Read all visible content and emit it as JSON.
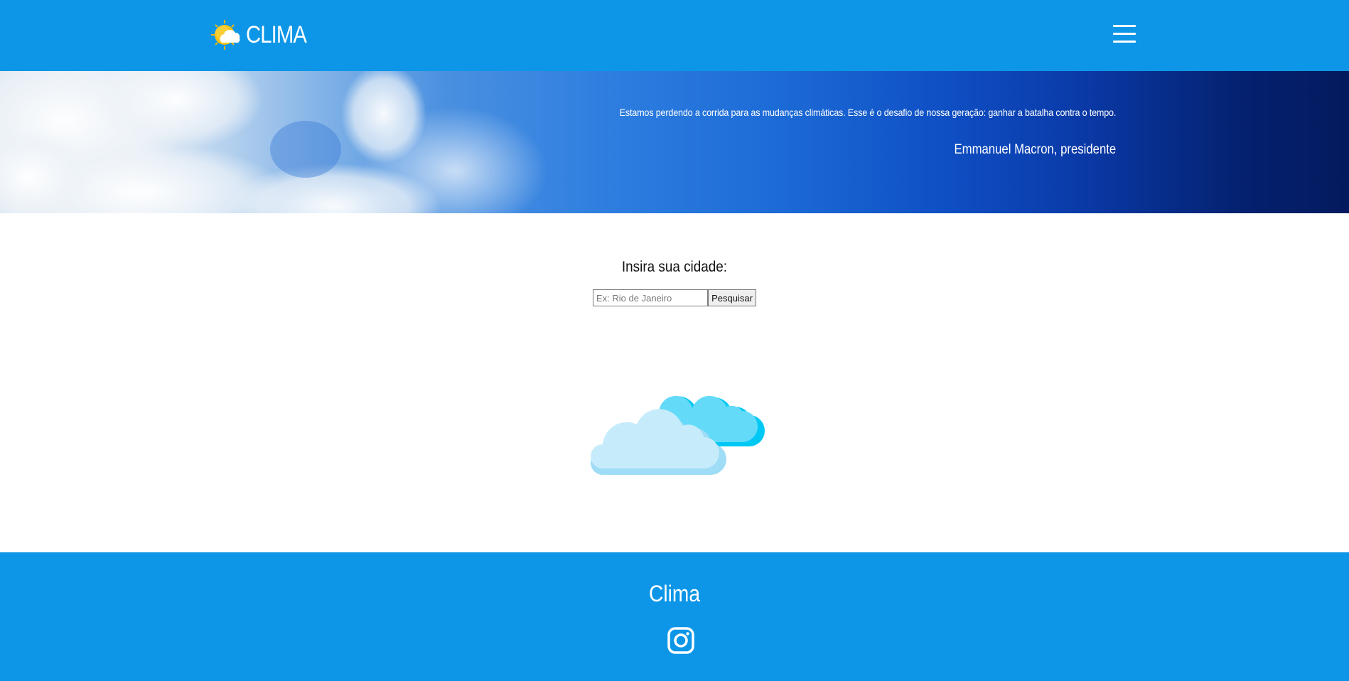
{
  "header": {
    "brand_name": "CLIMA",
    "logo_icon": "sun-cloud-icon",
    "menu_icon": "hamburger-menu-icon",
    "background_color": "#0d96e7"
  },
  "hero": {
    "quote": "Estamos perdendo a corrida para as mudanças climáticas. Esse é o desafio de nossa geração: ganhar a batalha contra o tempo.",
    "author": "Emmanuel Macron, presidente"
  },
  "search": {
    "label": "Insira sua cidade:",
    "placeholder": "Ex: Rio de Janeiro",
    "value": "",
    "button_label": "Pesquisar"
  },
  "illustration": {
    "icon": "clouds-icon",
    "colors": [
      "#c6ecfb",
      "#63daf8",
      "#00c8f5"
    ]
  },
  "footer": {
    "title": "Clima",
    "social_icon": "instagram-icon",
    "background_color": "#0d96e7"
  }
}
